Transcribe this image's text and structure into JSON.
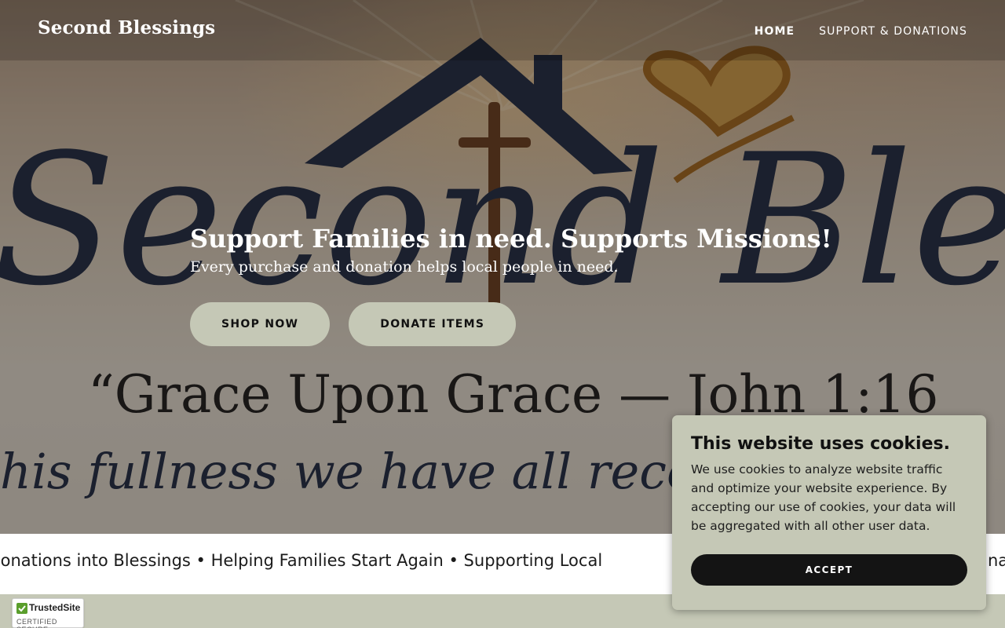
{
  "header": {
    "logo": "Second Blessings",
    "nav": [
      {
        "label": "HOME",
        "active": true
      },
      {
        "label": "SUPPORT & DONATIONS",
        "active": false
      }
    ]
  },
  "hero": {
    "background_lettering": [
      "Second Blessings",
      "“Grace Upon Grace — John 1:16",
      "his fullness we have all received, gr"
    ],
    "title": "Support Families in need. Supports Missions!",
    "subtitle": "Every purchase and donation helps local people in need.",
    "buttons": [
      "SHOP NOW",
      "DONATE ITEMS"
    ]
  },
  "marquee": {
    "text": "ning Donations into Blessings • Helping Families Start Again • Supporting Local",
    "trailing": "nat"
  },
  "badge": {
    "name": "TrustedSite",
    "subtitle": "CERTIFIED SECURE",
    "icon": "check-icon"
  },
  "cookie": {
    "title": "This website uses cookies.",
    "body": "We use cookies to analyze website traffic and optimize your website experience. By accepting our use of cookies, your data will be aggregated with all other user data.",
    "button": "ACCEPT"
  },
  "colors": {
    "sage": "#c5c8b6",
    "navy": "#1d2a45",
    "gold": "#c88a2c",
    "accept_button": "#141414"
  }
}
